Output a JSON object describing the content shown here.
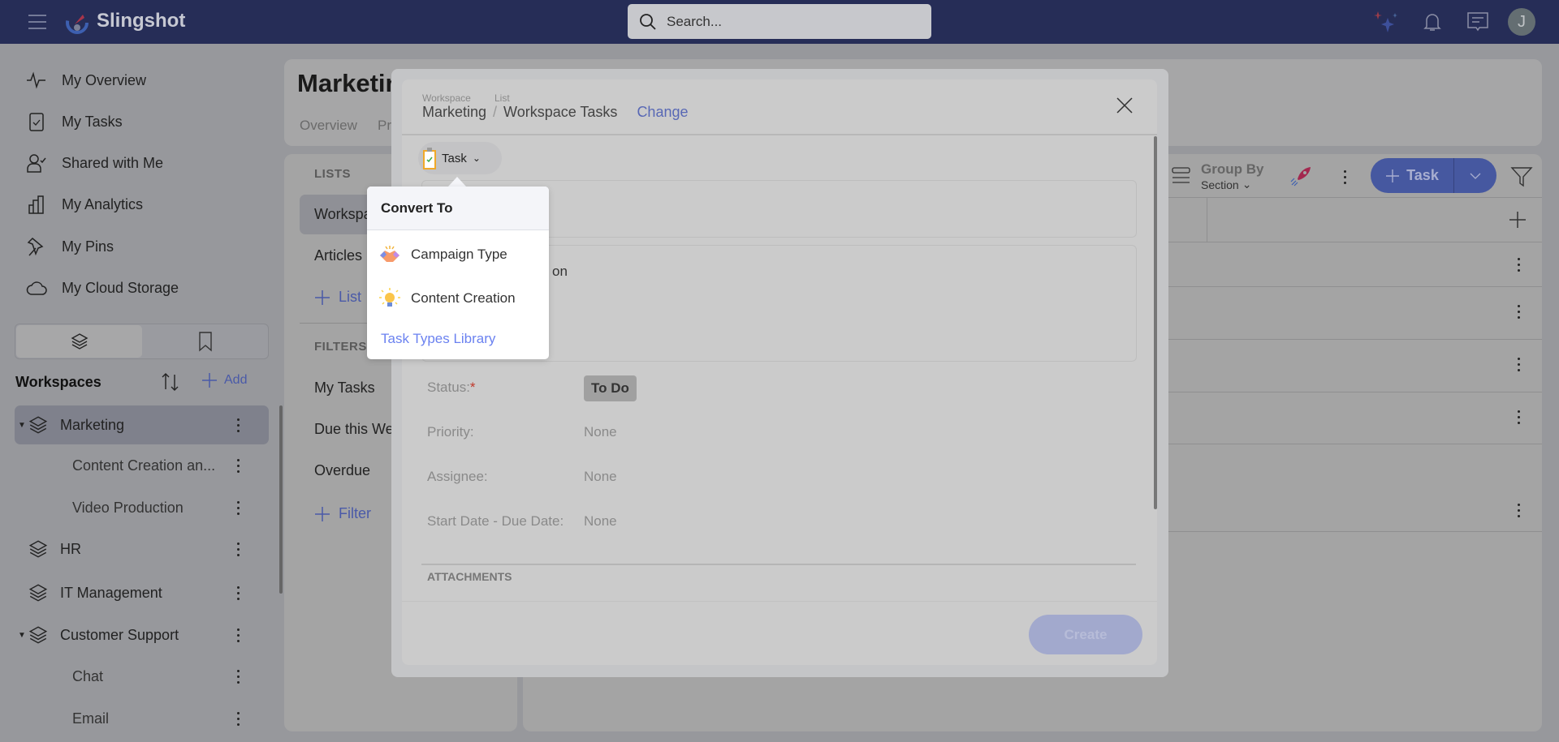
{
  "topbar": {
    "app_name": "Slingshot",
    "search_placeholder": "Search...",
    "avatar_initial": "J",
    "colors": {
      "bar": "#262d57"
    }
  },
  "sidebar": {
    "nav": [
      {
        "label": "My Overview",
        "icon": "activity-icon"
      },
      {
        "label": "My Tasks",
        "icon": "clipboard-check-icon"
      },
      {
        "label": "Shared with Me",
        "icon": "user-check-icon"
      },
      {
        "label": "My Analytics",
        "icon": "bar-chart-icon"
      },
      {
        "label": "My Pins",
        "icon": "pin-icon"
      },
      {
        "label": "My Cloud Storage",
        "icon": "cloud-icon"
      }
    ],
    "workspaces_title": "Workspaces",
    "add_label": "Add",
    "workspaces": [
      {
        "label": "Marketing",
        "level": 0,
        "expanded": true,
        "selected": true
      },
      {
        "label": "Content Creation an...",
        "level": 1
      },
      {
        "label": "Video Production",
        "level": 1
      },
      {
        "label": "HR",
        "level": 0
      },
      {
        "label": "IT Management",
        "level": 0
      },
      {
        "label": "Customer Support",
        "level": 0,
        "expanded": true
      },
      {
        "label": "Chat",
        "level": 1
      },
      {
        "label": "Email",
        "level": 1
      }
    ]
  },
  "header": {
    "title": "Marketin",
    "tabs": [
      "Overview",
      "Pr"
    ]
  },
  "lists_panel": {
    "lists_title": "LISTS",
    "lists": [
      "Workspa",
      "Articles"
    ],
    "add_list": "List",
    "filters_title": "FILTERS",
    "filters": [
      "My Tasks",
      "Due this Wee",
      "Overdue"
    ],
    "add_filter": "Filter"
  },
  "toolbar": {
    "group_by": "Group By",
    "group_value": "Section",
    "task_button": "Task"
  },
  "modal": {
    "workspace_caption": "Workspace",
    "workspace": "Marketing",
    "list_caption": "List",
    "list": "Workspace Tasks",
    "change": "Change",
    "type_chip": "Task",
    "description_fragment": "on",
    "fields": [
      {
        "label": "Status:",
        "value": "To Do",
        "required": true
      },
      {
        "label": "Priority:",
        "value": "None"
      },
      {
        "label": "Assignee:",
        "value": "None"
      },
      {
        "label": "Start Date - Due Date:",
        "value": "None"
      }
    ],
    "attachments": "ATTACHMENTS",
    "create": "Create"
  },
  "popup": {
    "title": "Convert To",
    "items": [
      {
        "label": "Campaign Type",
        "icon": "handshake-icon"
      },
      {
        "label": "Content Creation",
        "icon": "lightbulb-icon"
      }
    ],
    "library_link": "Task Types Library"
  }
}
